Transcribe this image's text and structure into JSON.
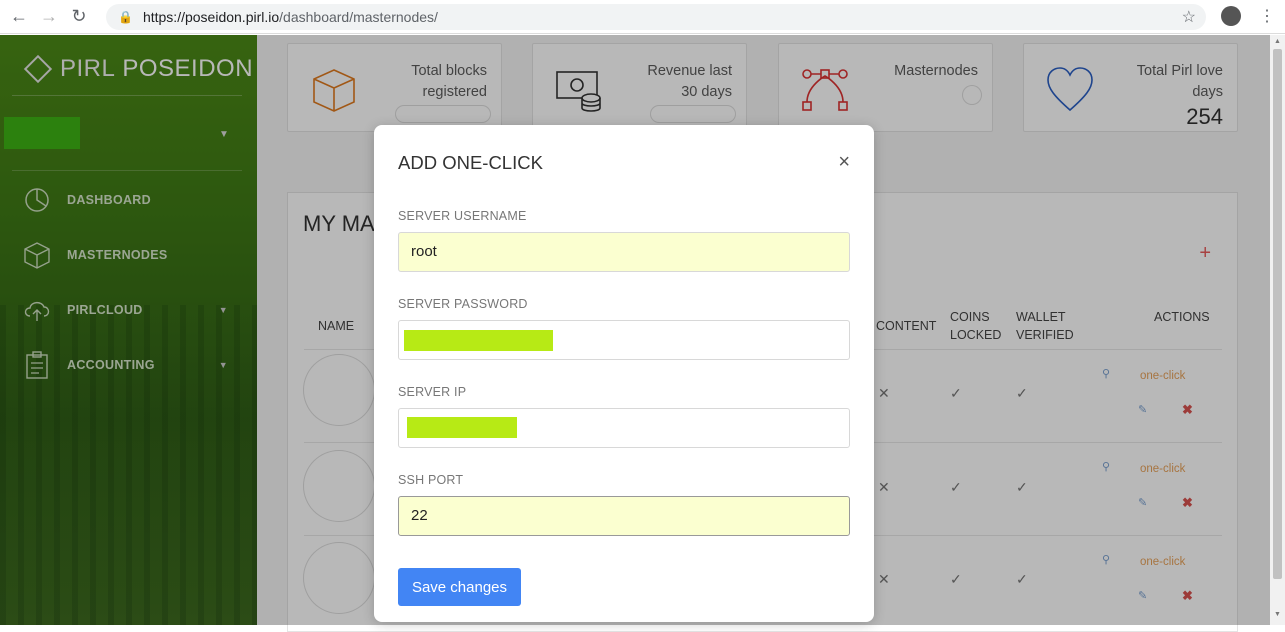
{
  "browser": {
    "url_host": "https://poseidon.pirl.io",
    "url_path": "/dashboard/masternodes/"
  },
  "sidebar": {
    "logo_first": "PIRL",
    "logo_second": "POSEIDON",
    "items": [
      {
        "label": "DASHBOARD",
        "icon": "pie-chart-icon"
      },
      {
        "label": "MASTERNODES",
        "icon": "cube-icon"
      },
      {
        "label": "PIRLCLOUD",
        "icon": "cloud-upload-icon"
      },
      {
        "label": "ACCOUNTING",
        "icon": "clipboard-icon"
      }
    ]
  },
  "stats": {
    "total_blocks_label": "Total blocks registered",
    "revenue_label": "Revenue last 30 days",
    "masternodes_label": "Masternodes",
    "love_days_label": "Total Pirl love days",
    "love_days_value": "254"
  },
  "panel": {
    "title_partial": "MY MA",
    "headers": {
      "name": "NAME",
      "content": "CONTENT",
      "coins_locked": "COINS LOCKED",
      "wallet_verified": "WALLET VERIFIED",
      "actions": "ACTIONS"
    },
    "rows": [
      {
        "content": "✕",
        "coins": "✓",
        "wallet": "✓",
        "action": "one-click"
      },
      {
        "content": "✕",
        "coins": "✓",
        "wallet": "✓",
        "action": "one-click"
      },
      {
        "content": "✕",
        "coins": "✓",
        "wallet": "✓",
        "action": "one-click"
      }
    ]
  },
  "modal": {
    "title": "ADD ONE-CLICK",
    "close": "×",
    "username_label": "SERVER USERNAME",
    "username_value": "root",
    "password_label": "SERVER PASSWORD",
    "ip_label": "SERVER IP",
    "port_label": "SSH PORT",
    "port_value": "22",
    "save_label": "Save changes"
  },
  "colors": {
    "accent": "#4285f4",
    "sidebar": "#3f7a15",
    "autofill": "#fbffd0",
    "redaction": "#b7ea15"
  }
}
